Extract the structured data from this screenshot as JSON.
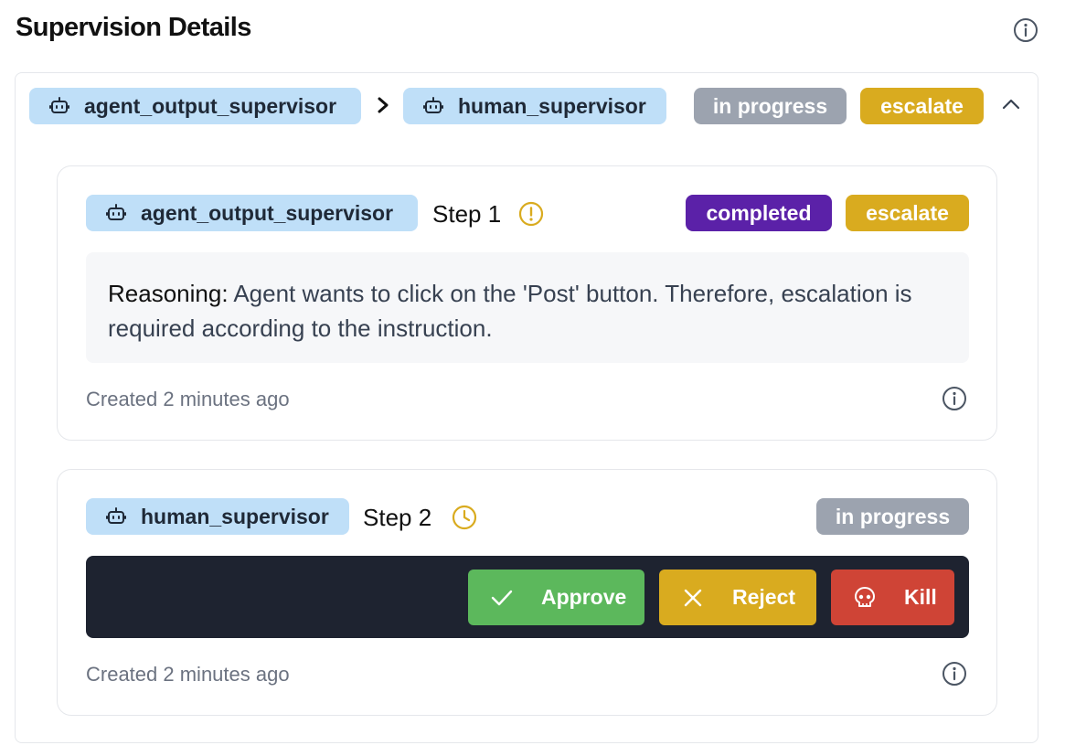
{
  "header": {
    "title": "Supervision Details"
  },
  "chain": {
    "from": "agent_output_supervisor",
    "to": "human_supervisor",
    "status": "in progress",
    "decision": "escalate"
  },
  "steps": [
    {
      "supervisor": "agent_output_supervisor",
      "step_label": "Step 1",
      "status": "completed",
      "decision": "escalate",
      "reasoning_label": "Reasoning:",
      "reasoning_text": " Agent wants to click on the 'Post' button. Therefore, escalation is required according to the instruction.",
      "created": "Created 2 minutes ago"
    },
    {
      "supervisor": "human_supervisor",
      "step_label": "Step 2",
      "status": "in progress",
      "actions": {
        "approve": "Approve",
        "reject": "Reject",
        "kill": "Kill"
      },
      "created": "Created 2 minutes ago"
    }
  ],
  "colors": {
    "chip_bg": "#bfdff8",
    "status_gray": "#9ca3af",
    "escalate_gold": "#d9ab1f",
    "completed_purple": "#5b21a8",
    "approve_green": "#5cb85c",
    "kill_red": "#cf4436",
    "action_bar": "#1e2330"
  },
  "icons": [
    "info-icon",
    "robot-icon",
    "chevron-right-icon",
    "chevron-up-icon",
    "warning-circle-icon",
    "clock-icon",
    "check-icon",
    "x-icon",
    "skull-icon"
  ]
}
